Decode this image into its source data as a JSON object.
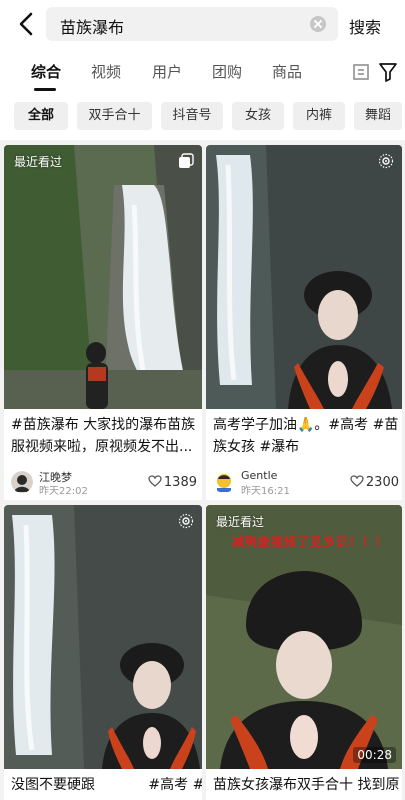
{
  "search": {
    "query": "苗族瀑布",
    "button_label": "搜索"
  },
  "tabs": [
    {
      "label": "综合",
      "active": true
    },
    {
      "label": "视频"
    },
    {
      "label": "用户"
    },
    {
      "label": "团购"
    },
    {
      "label": "商品"
    }
  ],
  "filters": [
    {
      "label": "全部",
      "active": true
    },
    {
      "label": "双手合十"
    },
    {
      "label": "抖音号"
    },
    {
      "label": "女孩"
    },
    {
      "label": "内裤"
    },
    {
      "label": "舞蹈"
    }
  ],
  "cards": [
    {
      "badge": "最近看过",
      "top_icon": "multi-image-icon",
      "caption_line1": "#苗族瀑布  大家找的瀑布苗族",
      "caption_line2": "服视频来啦，原视频发不出...",
      "author": "江晚梦",
      "time": "昨天22:02",
      "likes": "1389"
    },
    {
      "top_icon": "live-photo-icon",
      "caption_line1": "高考学子加油🙏。#高考 #苗",
      "caption_line2": "族女孩 #瀑布",
      "author": "Gentle",
      "time": "昨天16:21",
      "likes": "2300"
    },
    {
      "top_icon": "live-photo-icon",
      "caption_line1": "没图不要硬跟            #高考 #高"
    },
    {
      "badge": "最近看过",
      "overlay": "减到废视频了见多识！！！",
      "duration": "00:28",
      "caption_line1": "苗族女孩瀑布双手合十 找到原"
    }
  ],
  "colors": {
    "accent": "#111111",
    "overlay_red": "#d92020",
    "heart_gray": "#555555"
  }
}
